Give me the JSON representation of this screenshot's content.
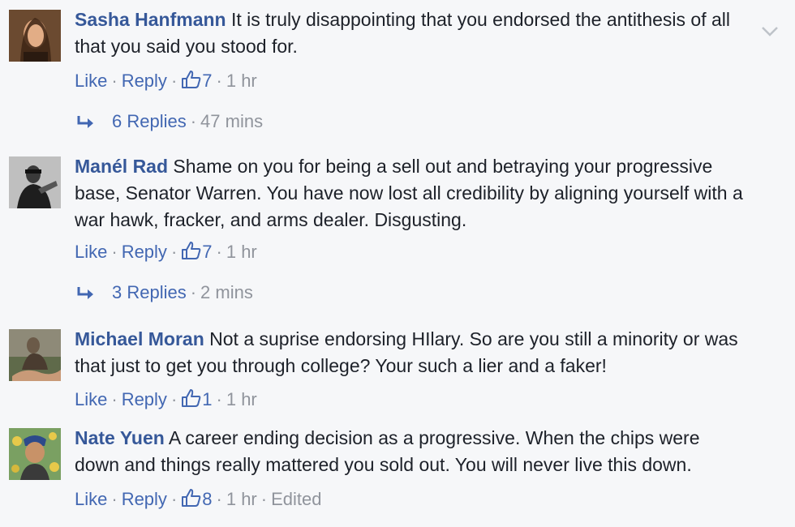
{
  "comments": [
    {
      "author": "Sasha Hanfmann",
      "text": "It is truly disappointing that you endorsed the antithesis of all that you said you stood for.",
      "like": "Like",
      "reply": "Reply",
      "likes": "7",
      "time": "1 hr",
      "replies": {
        "label": "6 Replies",
        "time": "47 mins"
      }
    },
    {
      "author": "Manél Rad",
      "text": "Shame on you for being a sell out and betraying your progressive base, Senator Warren. You have now lost all credibility by aligning yourself with a war hawk, fracker, and arms dealer. Disgusting.",
      "like": "Like",
      "reply": "Reply",
      "likes": "7",
      "time": "1 hr",
      "replies": {
        "label": "3 Replies",
        "time": "2 mins"
      }
    },
    {
      "author": "Michael Moran",
      "text": "Not a suprise endorsing HIlary. So are you still a minority or was that just to get you through college? Your such a lier and a faker!",
      "like": "Like",
      "reply": "Reply",
      "likes": "1",
      "time": "1 hr"
    },
    {
      "author": "Nate Yuen",
      "text": "A career ending decision as a progressive. When the chips were down and things really mattered you sold out. You will never live this down.",
      "like": "Like",
      "reply": "Reply",
      "likes": "8",
      "time": "1 hr",
      "edited": "Edited"
    }
  ],
  "colors": {
    "background": "#f6f7f9",
    "author": "#365899",
    "link": "#4267b2",
    "meta": "#90949c",
    "text": "#1d2129"
  },
  "icons": [
    "comment-options-chevron-icon",
    "like-thumb-icon",
    "reply-arrow-icon"
  ]
}
